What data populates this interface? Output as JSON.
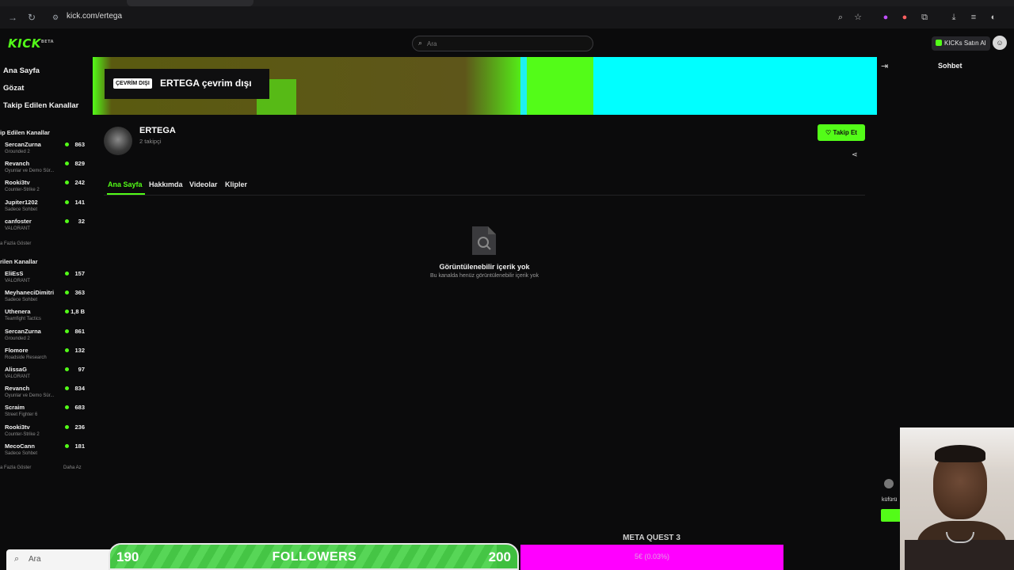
{
  "browser": {
    "url": "kick.com/ertega"
  },
  "header": {
    "logo": "KICK",
    "logo_sup": "BETA",
    "search_placeholder": "Ara",
    "buy_kicks": "KICKs Satın Al"
  },
  "sidebar": {
    "nav": [
      "Ana Sayfa",
      "Gözat",
      "Takip Edilen Kanallar"
    ],
    "followed_title": "ip Edilen Kanallar",
    "followed": [
      {
        "name": "SercanZurna",
        "category": "Grounded 2",
        "viewers": "863"
      },
      {
        "name": "Revanch",
        "category": "Oyunlar ve Demo Sür...",
        "viewers": "829"
      },
      {
        "name": "Rooki3tv",
        "category": "Counter-Strike 2",
        "viewers": "242"
      },
      {
        "name": "Jupiter1202",
        "category": "Sadece Sohbet",
        "viewers": "141"
      },
      {
        "name": "canfoster",
        "category": "VALORANT",
        "viewers": "32"
      }
    ],
    "followed_more": "a Fazla Göster",
    "recommended_title": "rilen Kanallar",
    "recommended": [
      {
        "name": "EliEsS",
        "category": "VALORANT",
        "viewers": "157"
      },
      {
        "name": "MeyhaneciDimitri",
        "category": "Sadece Sohbet",
        "viewers": "363"
      },
      {
        "name": "Uthenera",
        "category": "Teamfight Tactics",
        "viewers": "1,8 B"
      },
      {
        "name": "SercanZurna",
        "category": "Grounded 2",
        "viewers": "861"
      },
      {
        "name": "Flomore",
        "category": "Roadside Research",
        "viewers": "132"
      },
      {
        "name": "AlissaG",
        "category": "VALORANT",
        "viewers": "97"
      },
      {
        "name": "Revanch",
        "category": "Oyunlar ve Demo Sür...",
        "viewers": "834"
      },
      {
        "name": "Scraim",
        "category": "Street Fighter 6",
        "viewers": "683"
      },
      {
        "name": "Rooki3tv",
        "category": "Counter-Strike 2",
        "viewers": "236"
      },
      {
        "name": "MecoCann",
        "category": "Sadece Sohbet",
        "viewers": "181"
      }
    ],
    "recommended_more": "a Fazla Göster",
    "recommended_less": "Daha Az"
  },
  "banner": {
    "offline_badge": "ÇEVRİM DIŞI",
    "offline_text": "ERTEGA çevrim dışı"
  },
  "chat": {
    "title": "Sohbet",
    "partial_text": "küfürü"
  },
  "channel": {
    "name": "ERTEGA",
    "followers": "2 takipçi",
    "follow_label": "Takip Et",
    "tabs": [
      "Ana Sayfa",
      "Hakkımda",
      "Videolar",
      "Klipler"
    ],
    "empty_title": "Görüntülenebilir içerik yok",
    "empty_subtitle": "Bu kanalda henüz görüntülenebilir içerik yok"
  },
  "overlay": {
    "taskbar_search": "Ara",
    "followers_current": "190",
    "followers_label": "FOLLOWERS",
    "followers_goal": "200",
    "followers_progress": 0.95,
    "donation_title": "META QUEST 3",
    "donation_text": "5€ (0.03%)"
  },
  "colors": {
    "brand_green": "#53fc18",
    "magenta": "#ff00ff",
    "cyan": "#00ffff"
  }
}
